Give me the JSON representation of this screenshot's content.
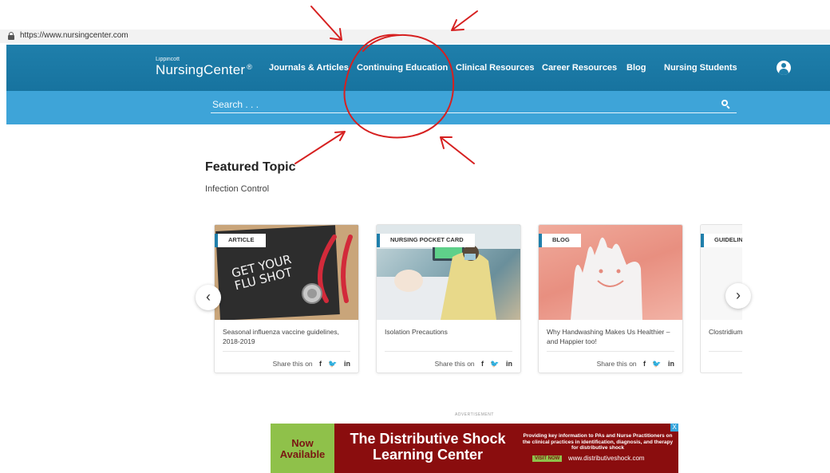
{
  "browser": {
    "url": "https://www.nursingcenter.com"
  },
  "header": {
    "brand_small": "Lippincott",
    "brand_name": "NursingCenter",
    "brand_reg": "®",
    "nav": [
      {
        "label": "Journals & Articles"
      },
      {
        "label": "Continuing Education"
      },
      {
        "label": "Clinical Resources"
      },
      {
        "label": "Career Resources"
      },
      {
        "label": "Blog"
      },
      {
        "label": "Nursing Students"
      }
    ]
  },
  "search": {
    "placeholder": "Search . . ."
  },
  "featured": {
    "title": "Featured Topic",
    "subtitle": "Infection Control"
  },
  "cards": [
    {
      "tag": "ARTICLE",
      "title": "Seasonal influenza vaccine guidelines, 2018-2019",
      "share": "Share this on",
      "image_text": "GET YOUR FLU SHOT"
    },
    {
      "tag": "NURSING POCKET CARD",
      "title": "Isolation Precautions",
      "share": "Share this on"
    },
    {
      "tag": "BLOG",
      "title": "Why Handwashing Makes Us Healthier – and Happier too!",
      "share": "Share this on"
    },
    {
      "tag": "GUIDELINE",
      "title": "Clostridium"
    }
  ],
  "social": {
    "facebook": "f",
    "twitter": "🐦",
    "linkedin": "in"
  },
  "carousel": {
    "prev": "‹",
    "next": "›"
  },
  "ad": {
    "label": "ADVERTISEMENT",
    "now_available": "Now Available",
    "headline_1": "The Distributive Shock",
    "headline_2": "Learning Center",
    "body": "Providing key information to PAs and Nurse Practitioners on the clinical practices in identification, diagnosis, and therapy for distributive shock",
    "visit": "VISIT NOW",
    "site": "www.distributiveshock.com",
    "close": "X"
  },
  "colors": {
    "header": "#1f7fab",
    "search_band": "#3ea4d8",
    "annotation": "#d62020"
  }
}
